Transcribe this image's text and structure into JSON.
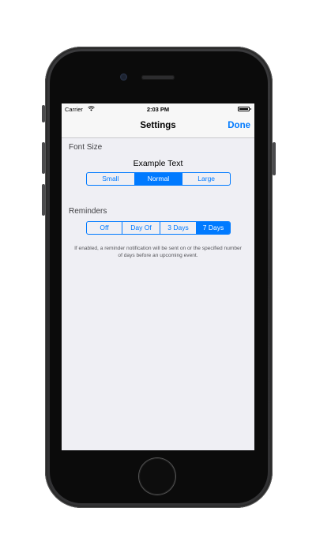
{
  "status_bar": {
    "carrier": "Carrier",
    "time": "2:03 PM",
    "wifi_icon": "wifi-icon",
    "battery_icon": "battery-icon"
  },
  "nav_bar": {
    "title": "Settings",
    "done_label": "Done"
  },
  "font_size": {
    "section_label": "Font Size",
    "example_text": "Example Text",
    "options": [
      "Small",
      "Normal",
      "Large"
    ],
    "selected": "Normal"
  },
  "reminders": {
    "section_label": "Reminders",
    "options": [
      "Off",
      "Day Of",
      "3 Days",
      "7 Days"
    ],
    "selected": "7 Days",
    "footnote": "If enabled, a reminder notification will be sent on or the specified number of days before an upcoming event."
  },
  "colors": {
    "accent": "#007aff",
    "background": "#efeff4",
    "phone_body": "#2b2b2d"
  }
}
